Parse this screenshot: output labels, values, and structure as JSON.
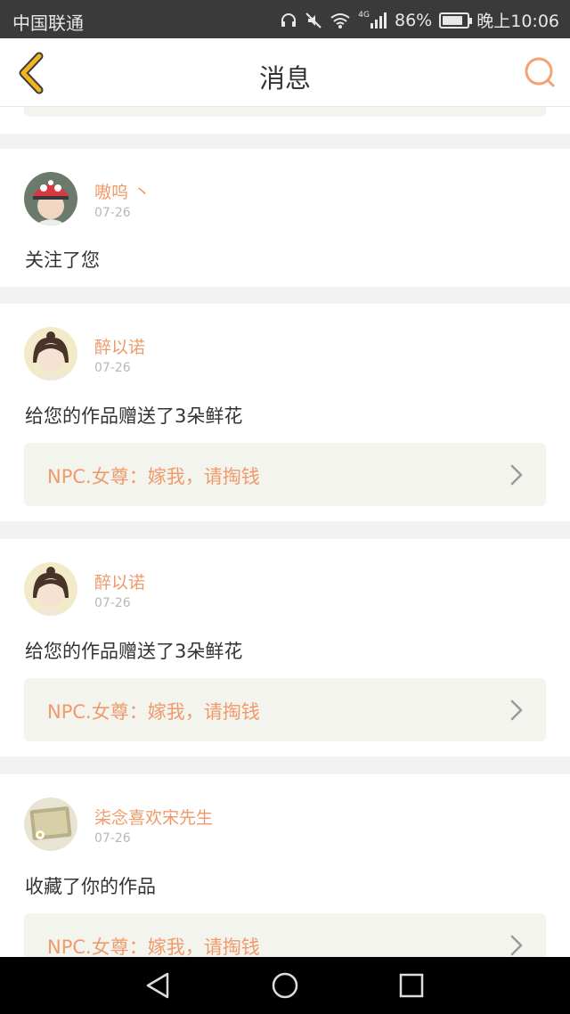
{
  "status_bar": {
    "carrier": "中国联通",
    "network": "4G",
    "battery_text": "86%",
    "battery_level": 0.86,
    "time": "晚上10:06"
  },
  "header": {
    "title": "消息"
  },
  "messages": [
    {
      "username": "嗷呜 丶",
      "date": "07-26",
      "text": "关注了您"
    },
    {
      "username": "醉以诺",
      "date": "07-26",
      "text": "给您的作品赠送了3朵鲜花",
      "work_title": "NPC.女尊：嫁我，请掏钱"
    },
    {
      "username": "醉以诺",
      "date": "07-26",
      "text": "给您的作品赠送了3朵鲜花",
      "work_title": "NPC.女尊：嫁我，请掏钱"
    },
    {
      "username": "柒念喜欢宋先生",
      "date": "07-26",
      "text": "收藏了你的作品",
      "work_title": "NPC.女尊：嫁我，请掏钱"
    }
  ],
  "colors": {
    "accent": "#ef9a6a",
    "back_arrow": "#f3b51f",
    "search_icon": "#f3a273"
  }
}
